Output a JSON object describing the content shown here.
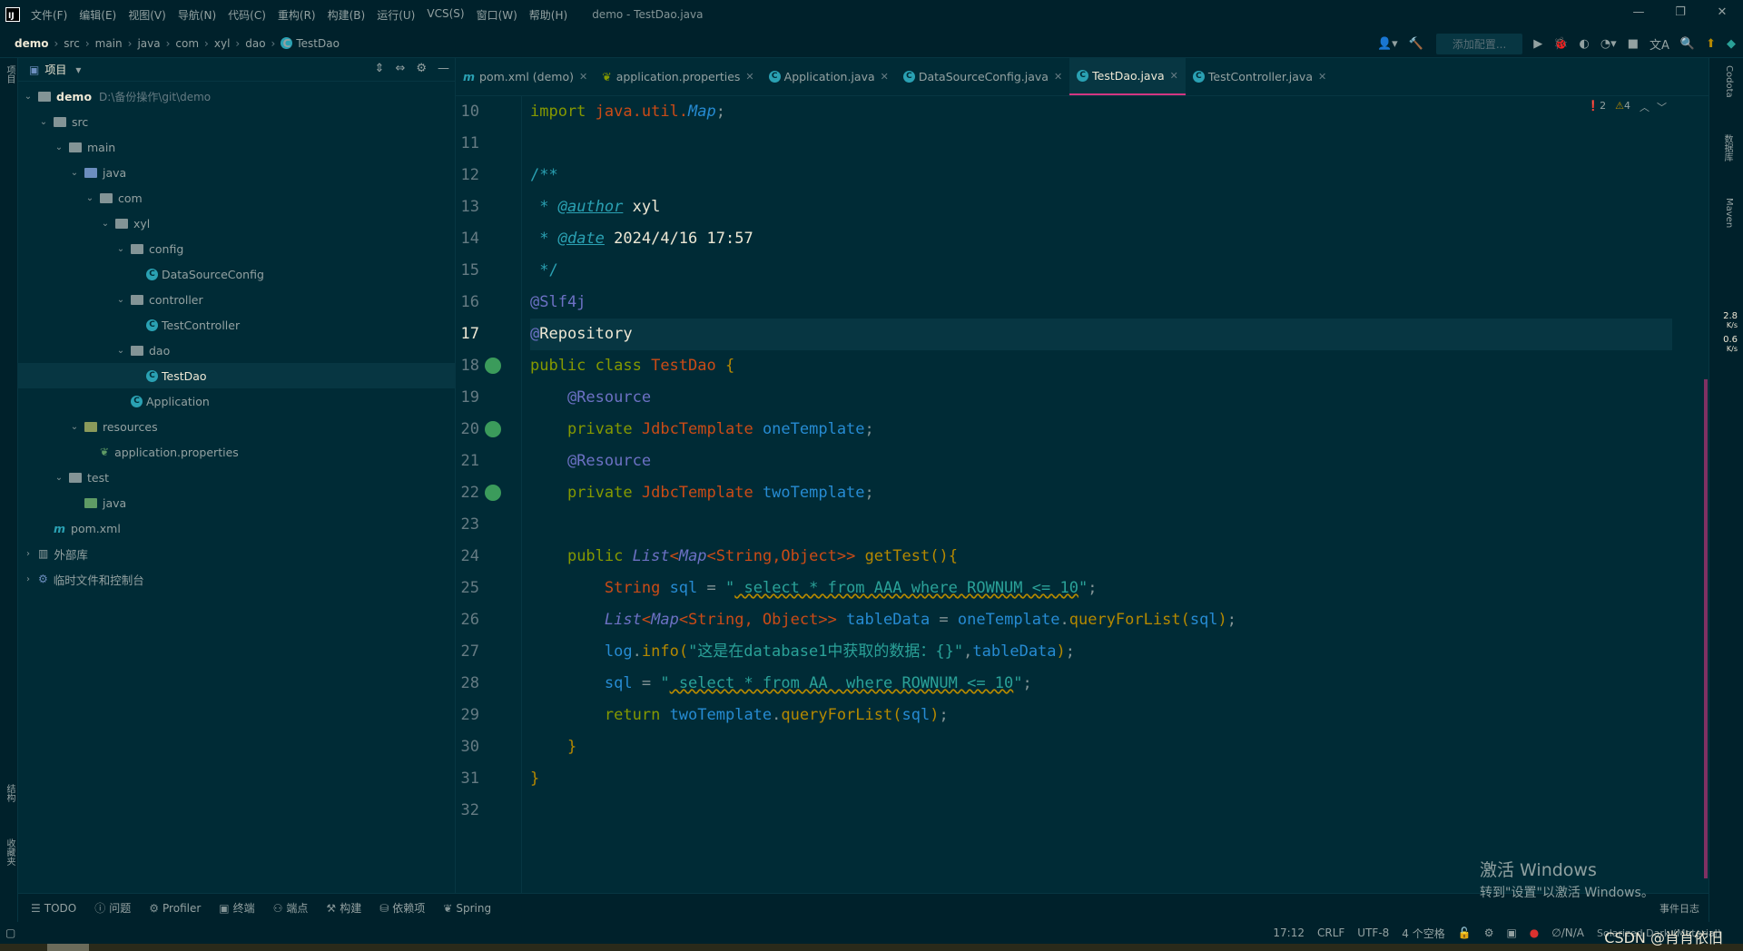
{
  "window": {
    "app_logo": "IJ",
    "menu": [
      "文件(F)",
      "编辑(E)",
      "视图(V)",
      "导航(N)",
      "代码(C)",
      "重构(R)",
      "构建(B)",
      "运行(U)",
      "VCS(S)",
      "窗口(W)",
      "帮助(H)"
    ],
    "title": "demo - TestDao.java",
    "controls": [
      "—",
      "❐",
      "✕"
    ]
  },
  "breadcrumb": [
    "demo",
    "src",
    "main",
    "java",
    "com",
    "xyl",
    "dao",
    "TestDao"
  ],
  "toolbar": {
    "run_config_placeholder": "添加配置..."
  },
  "project_panel": {
    "title": "项目",
    "tree": [
      {
        "label": "demo",
        "path": "D:\\备份操作\\git\\demo",
        "depth": 0,
        "type": "folder-root",
        "expanded": true
      },
      {
        "label": "src",
        "depth": 1,
        "type": "folder",
        "expanded": true
      },
      {
        "label": "main",
        "depth": 2,
        "type": "folder",
        "expanded": true
      },
      {
        "label": "java",
        "depth": 3,
        "type": "folder-src",
        "expanded": true
      },
      {
        "label": "com",
        "depth": 4,
        "type": "folder",
        "expanded": true
      },
      {
        "label": "xyl",
        "depth": 5,
        "type": "folder",
        "expanded": true
      },
      {
        "label": "config",
        "depth": 6,
        "type": "folder",
        "expanded": true
      },
      {
        "label": "DataSourceConfig",
        "depth": 7,
        "type": "class"
      },
      {
        "label": "controller",
        "depth": 6,
        "type": "folder",
        "expanded": true
      },
      {
        "label": "TestController",
        "depth": 7,
        "type": "class"
      },
      {
        "label": "dao",
        "depth": 6,
        "type": "folder",
        "expanded": true
      },
      {
        "label": "TestDao",
        "depth": 7,
        "type": "class",
        "selected": true
      },
      {
        "label": "Application",
        "depth": 6,
        "type": "spring-class"
      },
      {
        "label": "resources",
        "depth": 3,
        "type": "folder-res",
        "expanded": true
      },
      {
        "label": "application.properties",
        "depth": 4,
        "type": "properties"
      },
      {
        "label": "test",
        "depth": 2,
        "type": "folder",
        "expanded": true
      },
      {
        "label": "java",
        "depth": 3,
        "type": "folder-test"
      },
      {
        "label": "pom.xml",
        "depth": 1,
        "type": "maven"
      },
      {
        "label": "外部库",
        "depth": 0,
        "type": "library",
        "expanded": false
      },
      {
        "label": "临时文件和控制台",
        "depth": 0,
        "type": "scratch",
        "expanded": false
      }
    ]
  },
  "tabs": [
    {
      "label": "pom.xml (demo)",
      "icon": "m",
      "active": false
    },
    {
      "label": "application.properties",
      "icon": "leaf",
      "active": false
    },
    {
      "label": "Application.java",
      "icon": "spring",
      "active": false
    },
    {
      "label": "DataSourceConfig.java",
      "icon": "c",
      "active": false
    },
    {
      "label": "TestDao.java",
      "icon": "c",
      "active": true
    },
    {
      "label": "TestController.java",
      "icon": "c",
      "active": false
    }
  ],
  "inspections": {
    "errors": "2",
    "warnings": "4"
  },
  "code": {
    "line_numbers": [
      "10",
      "11",
      "12",
      "13",
      "14",
      "15",
      "16",
      "17",
      "18",
      "19",
      "20",
      "21",
      "22",
      "23",
      "24",
      "25",
      "26",
      "27",
      "28",
      "29",
      "30",
      "31",
      "32"
    ],
    "current_line": "17",
    "author": "xyl",
    "date": "2024/4/16 17:57",
    "sql1": " select * from AAA where ROWNUM <= 10",
    "sql2": " select * from AA  where ROWNUM <= 10",
    "log_msg": "这是在database1中获取的数据：{}"
  },
  "left_strip": {
    "top_label": "项目",
    "mid_label": "结构",
    "bottom_label": "收藏夹"
  },
  "right_strip": {
    "labels": [
      "Codota",
      "数据库",
      "Maven"
    ],
    "speed_up": "2.8",
    "speed_up_unit": "K/s",
    "speed_down": "0.6",
    "speed_down_unit": "K/s"
  },
  "bottom_tools": [
    "TODO",
    "问题",
    "Profiler",
    "终端",
    "端点",
    "构建",
    "依赖项",
    "Spring"
  ],
  "event_log": "事件日志",
  "status": {
    "position": "17:12",
    "line_sep": "CRLF",
    "encoding": "UTF-8",
    "indent": "4 个空格",
    "na": "∅/N/A",
    "theme": "Solarized Dark (Material)"
  },
  "activation": {
    "line1": "激活 Windows",
    "line2": "转到\"设置\"以激活 Windows。"
  },
  "watermark": "CSDN @肖肖依旧"
}
